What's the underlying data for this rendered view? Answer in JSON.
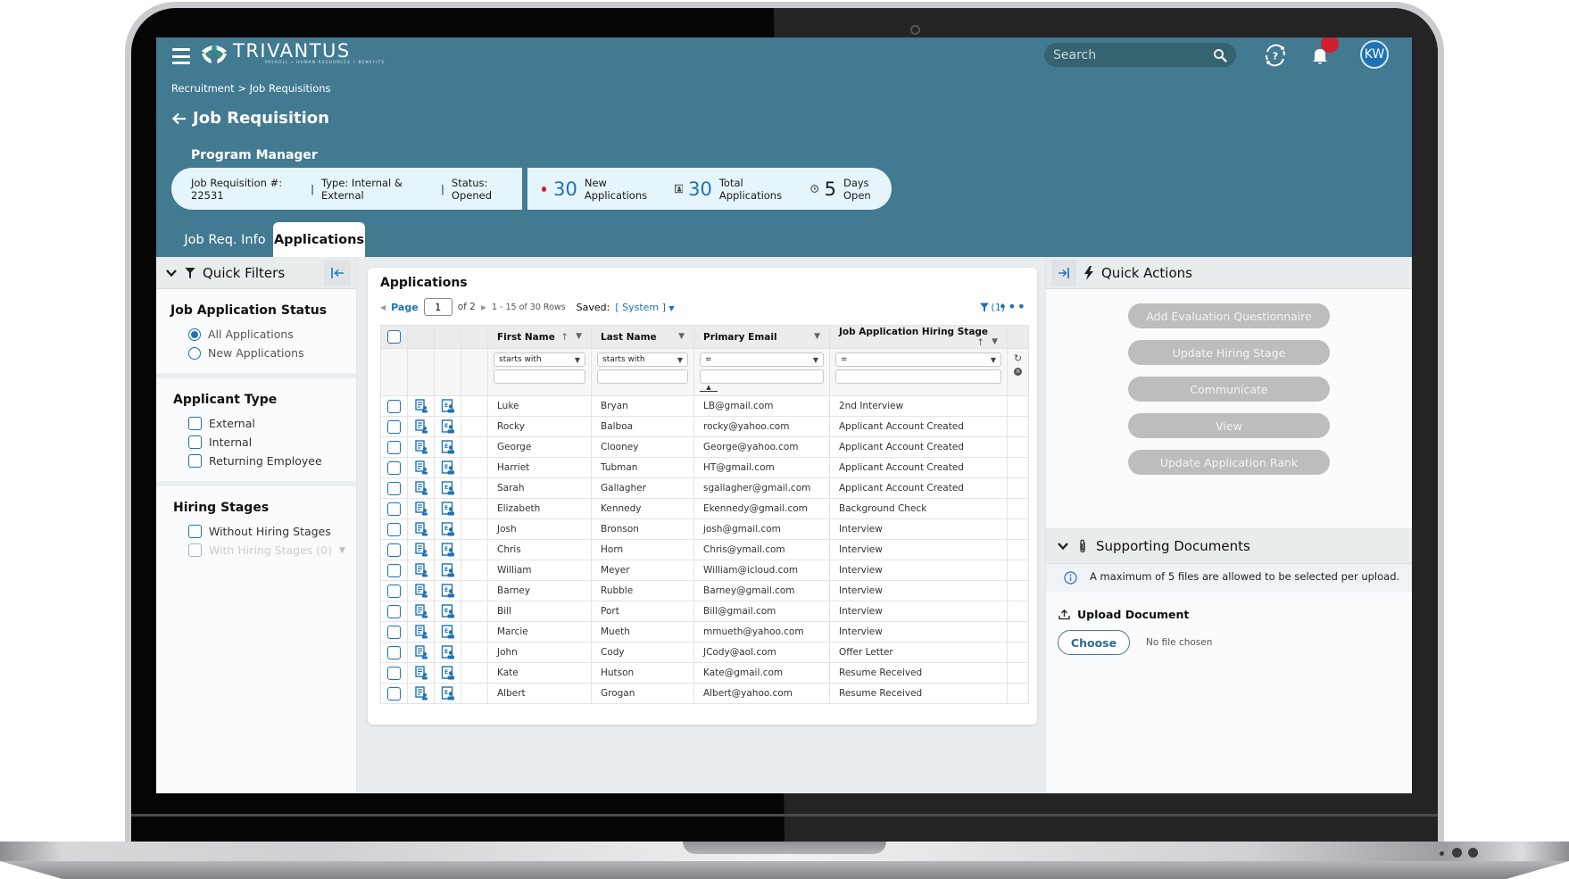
{
  "header": {
    "brand": "TRIVANTUS",
    "brand_tagline": "PAYROLL • HUMAN RESOURCES • BENEFITS",
    "search_placeholder": "Search",
    "avatar_initials": "KW",
    "notification_badge": true
  },
  "breadcrumb": {
    "parent": "Recruitment",
    "separator": ">",
    "current": "Job Requisitions"
  },
  "page_title": "Job Requisition",
  "job": {
    "title": "Program Manager",
    "requisition_label": "Job Requisition #: 22531",
    "type_label": "Type: Internal & External",
    "status_label": "Status: Opened",
    "separator": "|"
  },
  "stats": {
    "new_count": "30",
    "new_label": "New Applications",
    "total_count": "30",
    "total_label": "Total Applications",
    "days_count": "5",
    "days_label": "Days Open"
  },
  "tabs": [
    {
      "label": "Job Req. Info",
      "active": false
    },
    {
      "label": "Applications",
      "active": true
    }
  ],
  "quick_filters": {
    "title": "Quick Filters",
    "sections": {
      "status": {
        "title": "Job Application Status",
        "options": [
          {
            "label": "All Applications",
            "selected": true
          },
          {
            "label": "New Applications",
            "selected": false
          }
        ]
      },
      "applicant_type": {
        "title": "Applicant Type",
        "options": [
          {
            "label": "External",
            "checked": false
          },
          {
            "label": "Internal",
            "checked": false
          },
          {
            "label": "Returning Employee",
            "checked": false
          }
        ]
      },
      "hiring_stages": {
        "title": "Hiring Stages",
        "options": [
          {
            "label": "Without Hiring Stages",
            "checked": false,
            "disabled": false
          },
          {
            "label": "With Hiring Stages (0)",
            "checked": false,
            "disabled": true
          }
        ]
      }
    }
  },
  "applications": {
    "title": "Applications",
    "pager": {
      "page_label": "Page",
      "page_value": "1",
      "of_label": "of 2",
      "rows_label": "1 - 15 of 30 Rows",
      "saved_label": "Saved:",
      "saved_value": "[ System ]"
    },
    "filter_count": "(1)",
    "columns": [
      {
        "label": "First Name",
        "filter_op": "starts with",
        "sort": "asc"
      },
      {
        "label": "Last Name",
        "filter_op": "starts with",
        "sort": null
      },
      {
        "label": "Primary Email",
        "filter_op": "=",
        "sort": null
      },
      {
        "label": "Job Application Hiring Stage",
        "filter_op": "=",
        "sort": "asc"
      }
    ],
    "rows": [
      {
        "first": "Luke",
        "last": "Bryan",
        "email": "LB@gmail.com",
        "stage": "2nd Interview"
      },
      {
        "first": "Rocky",
        "last": "Balboa",
        "email": "rocky@yahoo.com",
        "stage": "Applicant Account Created"
      },
      {
        "first": "George",
        "last": "Clooney",
        "email": "George@yahoo.com",
        "stage": "Applicant Account Created"
      },
      {
        "first": "Harriet",
        "last": "Tubman",
        "email": "HT@gmail.com",
        "stage": "Applicant Account Created"
      },
      {
        "first": "Sarah",
        "last": "Gallagher",
        "email": "sgallagher@gmail.com",
        "stage": "Applicant Account Created"
      },
      {
        "first": "Elizabeth",
        "last": "Kennedy",
        "email": "Ekennedy@gmail.com",
        "stage": "Background Check"
      },
      {
        "first": "Josh",
        "last": "Bronson",
        "email": "josh@gmail.com",
        "stage": "Interview"
      },
      {
        "first": "Chris",
        "last": "Horn",
        "email": "Chris@ymail.com",
        "stage": "Interview"
      },
      {
        "first": "William",
        "last": "Meyer",
        "email": "William@icloud.com",
        "stage": "Interview"
      },
      {
        "first": "Barney",
        "last": "Rubble",
        "email": "Barney@gmail.com",
        "stage": "Interview"
      },
      {
        "first": "Bill",
        "last": "Port",
        "email": "Bill@gmail.com",
        "stage": "Interview"
      },
      {
        "first": "Marcie",
        "last": "Mueth",
        "email": "mmueth@yahoo.com",
        "stage": "Interview"
      },
      {
        "first": "John",
        "last": "Cody",
        "email": "JCody@aol.com",
        "stage": "Offer Letter"
      },
      {
        "first": "Kate",
        "last": "Hutson",
        "email": "Kate@gmail.com",
        "stage": "Resume Received"
      },
      {
        "first": "Albert",
        "last": "Grogan",
        "email": "Albert@yahoo.com",
        "stage": "Resume Received"
      }
    ]
  },
  "quick_actions": {
    "title": "Quick Actions",
    "buttons": [
      "Add Evaluation Questionnaire",
      "Update Hiring Stage",
      "Communicate",
      "View",
      "Update Application Rank"
    ]
  },
  "supporting_documents": {
    "title": "Supporting Documents",
    "note": "A maximum of 5 files are allowed to be selected per upload.",
    "upload_label": "Upload Document",
    "choose_label": "Choose",
    "no_file_label": "No file chosen"
  },
  "colors": {
    "header_bg": "#427a92",
    "accent_blue": "#1d73b5",
    "alert_red": "#cf2030",
    "disabled_button": "#bdbdbd"
  }
}
